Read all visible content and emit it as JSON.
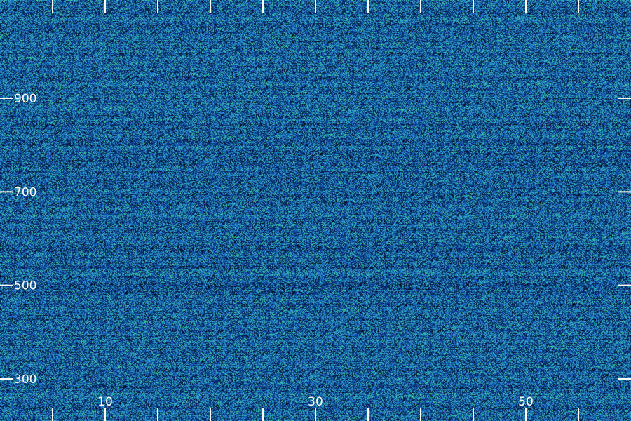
{
  "chart_data": {
    "type": "heatmap",
    "title": "",
    "xlabel": "",
    "ylabel": "",
    "xlim": [
      0,
      60
    ],
    "ylim": [
      210,
      1110
    ],
    "x_ticks": [
      {
        "value": 10,
        "label": "10"
      },
      {
        "value": 30,
        "label": "30"
      },
      {
        "value": 50,
        "label": "50"
      }
    ],
    "x_minor_ticks": [
      5,
      15,
      20,
      25,
      35,
      40,
      45,
      55
    ],
    "y_ticks": [
      {
        "value": 900,
        "label": "900"
      },
      {
        "value": 700,
        "label": "700"
      },
      {
        "value": 500,
        "label": "500"
      },
      {
        "value": 300,
        "label": "300"
      }
    ],
    "colormap": [
      "#000000",
      "#001a4d",
      "#0a3c8c",
      "#1e6ec8",
      "#2fa0c8",
      "#3cd29a"
    ],
    "grid": false,
    "legend": "none"
  }
}
